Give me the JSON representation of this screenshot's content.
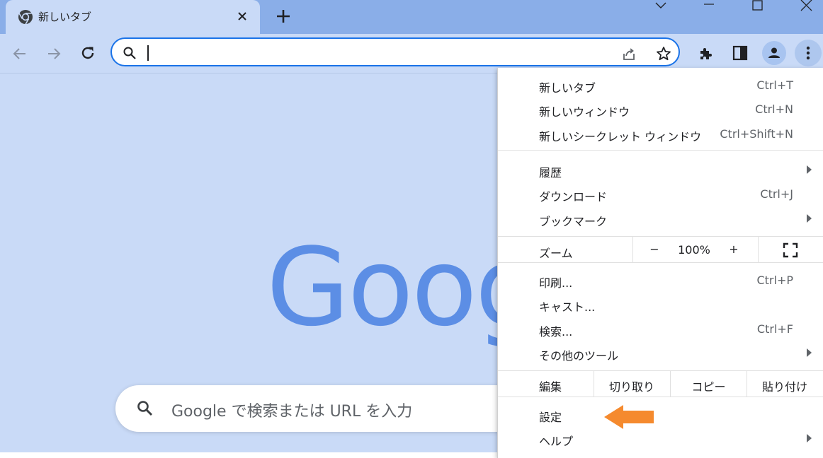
{
  "tab": {
    "title": "新しいタブ"
  },
  "colors": {
    "accent": "#1a73e8",
    "page_bg": "#c9daf7",
    "titlebar_bg": "#8aaee8",
    "logo": "#5c8ee5",
    "pointer_arrow": "#f58a2e"
  },
  "icons": {
    "chrome": "chrome-icon",
    "close": "close-icon",
    "new_tab": "plus-icon",
    "back": "back-arrow-icon",
    "forward": "forward-arrow-icon",
    "reload": "reload-icon",
    "search": "search-icon",
    "share": "share-icon",
    "bookmark": "star-icon",
    "extensions": "puzzle-icon",
    "side_panel": "side-panel-icon",
    "profile": "profile-icon",
    "more": "kebab-menu-icon",
    "fullscreen": "fullscreen-icon"
  },
  "omnibox": {
    "value": ""
  },
  "page": {
    "logo": "Goog",
    "search_placeholder": "Google で検索または URL を入力"
  },
  "menu": {
    "new_tab": {
      "label": "新しいタブ",
      "shortcut": "Ctrl+T"
    },
    "new_window": {
      "label": "新しいウィンドウ",
      "shortcut": "Ctrl+N"
    },
    "new_incognito": {
      "label": "新しいシークレット ウィンドウ",
      "shortcut": "Ctrl+Shift+N"
    },
    "history": {
      "label": "履歴"
    },
    "downloads": {
      "label": "ダウンロード",
      "shortcut": "Ctrl+J"
    },
    "bookmarks": {
      "label": "ブックマーク"
    },
    "zoom": {
      "label": "ズーム",
      "minus": "−",
      "value": "100%",
      "plus": "+"
    },
    "print": {
      "label": "印刷...",
      "shortcut": "Ctrl+P"
    },
    "cast": {
      "label": "キャスト..."
    },
    "find": {
      "label": "検索...",
      "shortcut": "Ctrl+F"
    },
    "more_tools": {
      "label": "その他のツール"
    },
    "edit": {
      "label": "編集",
      "cut": "切り取り",
      "copy": "コピー",
      "paste": "貼り付け"
    },
    "settings": {
      "label": "設定"
    },
    "help": {
      "label": "ヘルプ"
    }
  }
}
